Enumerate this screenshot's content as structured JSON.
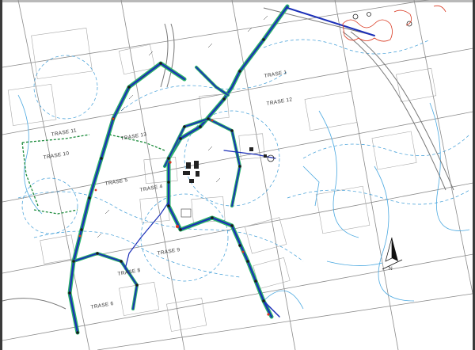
{
  "map": {
    "route_labels": [
      {
        "id": "trase-1",
        "text": "TRASE 1"
      },
      {
        "id": "trase-12",
        "text": "TRASE 12"
      },
      {
        "id": "trase-11",
        "text": "TRASE 11"
      },
      {
        "id": "trase-10",
        "text": "TRASE 10"
      },
      {
        "id": "trase-13",
        "text": "TRASE 13"
      },
      {
        "id": "trase-5",
        "text": "TRASE 5"
      },
      {
        "id": "trase-4",
        "text": "TRASE 4"
      },
      {
        "id": "trase-9",
        "text": "TRASE 9"
      },
      {
        "id": "trase-8",
        "text": "TRASE 8"
      },
      {
        "id": "trase-6",
        "text": "TRASE 6"
      }
    ],
    "north_label": "N",
    "colors": {
      "main_route": "#1b2fb8",
      "green_route": "#1a8a3a",
      "contour": "#3b9bd6",
      "parcel": "#9a9a9a",
      "grid": "#7a7a7a",
      "red": "#d9371f",
      "feature": "#555555"
    }
  }
}
